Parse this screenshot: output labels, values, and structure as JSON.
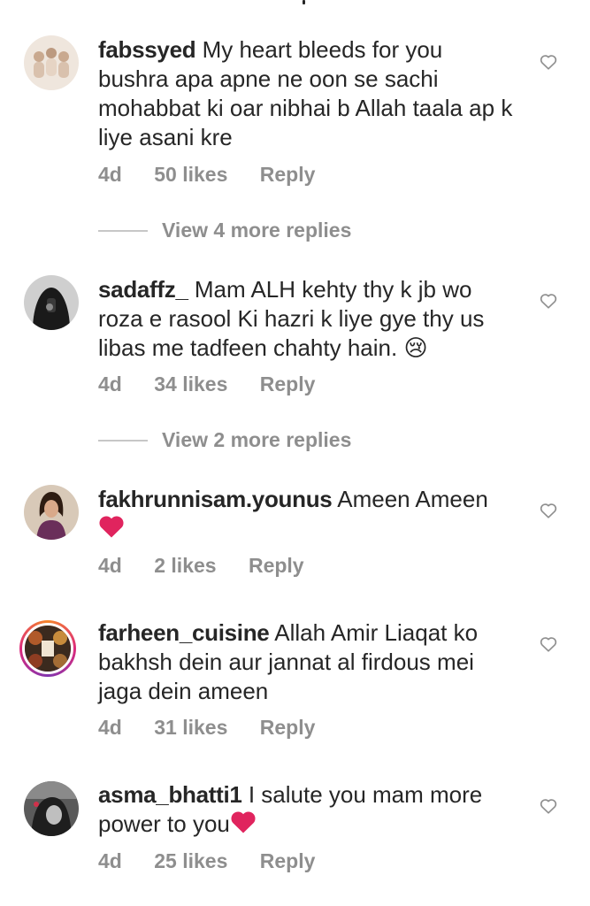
{
  "comments": [
    {
      "username": "fabssyed",
      "text": "My heart bleeds for you bushra apa apne ne oon se sachi mohabbat ki oar nibhai b Allah  taala ap k liye asani kre",
      "time": "4d",
      "likes": "50 likes",
      "reply": "Reply",
      "view_more": "View 4 more replies"
    },
    {
      "username": "sadaffz_",
      "text": "Mam ALH kehty thy k jb wo roza e rasool Ki hazri k liye gye thy us libas me tadfeen chahty hain. 😢",
      "time": "4d",
      "likes": "34 likes",
      "reply": "Reply",
      "view_more": "View 2 more replies"
    },
    {
      "username": "fakhrunnisam.younus",
      "text": "Ameen Ameen",
      "time": "4d",
      "likes": "2 likes",
      "reply": "Reply"
    },
    {
      "username": "farheen_cuisine",
      "text": "Allah Amir Liaqat ko bakhsh dein aur jannat al firdous mei jaga dein ameen",
      "time": "4d",
      "likes": "31 likes",
      "reply": "Reply"
    },
    {
      "username": "asma_bhatti1",
      "text": "I salute you mam more power to you",
      "time": "4d",
      "likes": "25 likes",
      "reply": "Reply"
    }
  ],
  "icons": {
    "like": "heart-outline-icon",
    "emoji_heart": "red-heart-emoji"
  },
  "colors": {
    "text": "#262626",
    "muted": "#8e8e8e",
    "heart": "#e0245e"
  }
}
